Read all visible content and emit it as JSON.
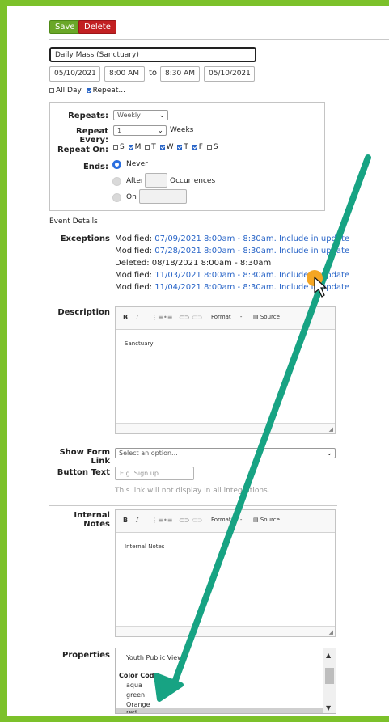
{
  "toolbar": {
    "save_label": "Save",
    "delete_label": "Delete"
  },
  "event": {
    "title": "Daily Mass (Sanctuary)",
    "start_date": "05/10/2021",
    "start_time": "8:00 AM",
    "to_label": "to",
    "end_time": "8:30 AM",
    "end_date": "05/10/2021",
    "all_day_label": "All Day",
    "repeat_label": "Repeat...",
    "all_day_checked": false,
    "repeat_checked": true
  },
  "repeat": {
    "repeats_label": "Repeats:",
    "repeats_value": "Weekly",
    "every_label": "Repeat Every:",
    "every_value": "1",
    "every_unit": "Weeks",
    "on_label": "Repeat On:",
    "days": [
      {
        "label": "S",
        "checked": false
      },
      {
        "label": "M",
        "checked": true
      },
      {
        "label": "T",
        "checked": false
      },
      {
        "label": "W",
        "checked": true
      },
      {
        "label": "T",
        "checked": true
      },
      {
        "label": "F",
        "checked": true
      },
      {
        "label": "S",
        "checked": false
      }
    ],
    "ends_label": "Ends:",
    "never_label": "Never",
    "after_label": "After",
    "occurrences_label": "Occurrences",
    "on_date_label": "On"
  },
  "event_details_label": "Event Details",
  "exceptions": {
    "label": "Exceptions",
    "items": [
      {
        "prefix": "Modified: ",
        "link": "07/09/2021 8:00am - 8:30am. Include in update"
      },
      {
        "prefix": "Modified: ",
        "link": "07/28/2021 8:00am - 8:30am. Include in update"
      },
      {
        "prefix": "Deleted: 08/18/2021 8:00am - 8:30am",
        "link": ""
      },
      {
        "prefix": "Modified: ",
        "link": "11/03/2021 8:00am - 8:30am. Include in update"
      },
      {
        "prefix": "Modified: ",
        "link": "11/04/2021 8:00am - 8:30am. Include in update"
      }
    ]
  },
  "description": {
    "label": "Description",
    "format_label": "Format",
    "source_label": "Source",
    "content": "Sanctuary"
  },
  "form_link": {
    "label": "Show Form Link",
    "placeholder": "Select an option...",
    "button_text_label": "Button Text",
    "button_text_placeholder": "E.g. Sign up",
    "note": "This link will not display in all integrations."
  },
  "internal_notes": {
    "label": "Internal Notes",
    "format_label": "Format",
    "source_label": "Source",
    "content": "Internal Notes"
  },
  "properties": {
    "label": "Properties",
    "items": [
      {
        "text": "Youth Public View",
        "group": false,
        "selected": false
      },
      {
        "text": "Color Code",
        "group": true,
        "selected": false
      },
      {
        "text": "aqua",
        "group": false,
        "selected": false
      },
      {
        "text": "green",
        "group": false,
        "selected": false
      },
      {
        "text": "Orange",
        "group": false,
        "selected": false
      },
      {
        "text": "red",
        "group": false,
        "selected": true
      }
    ]
  },
  "colors": {
    "frame": "#7cc12a",
    "save": "#6aa728",
    "delete": "#c22022",
    "link": "#2a66c8",
    "arrow": "#17a383",
    "cursor_dot": "#f5a623"
  }
}
